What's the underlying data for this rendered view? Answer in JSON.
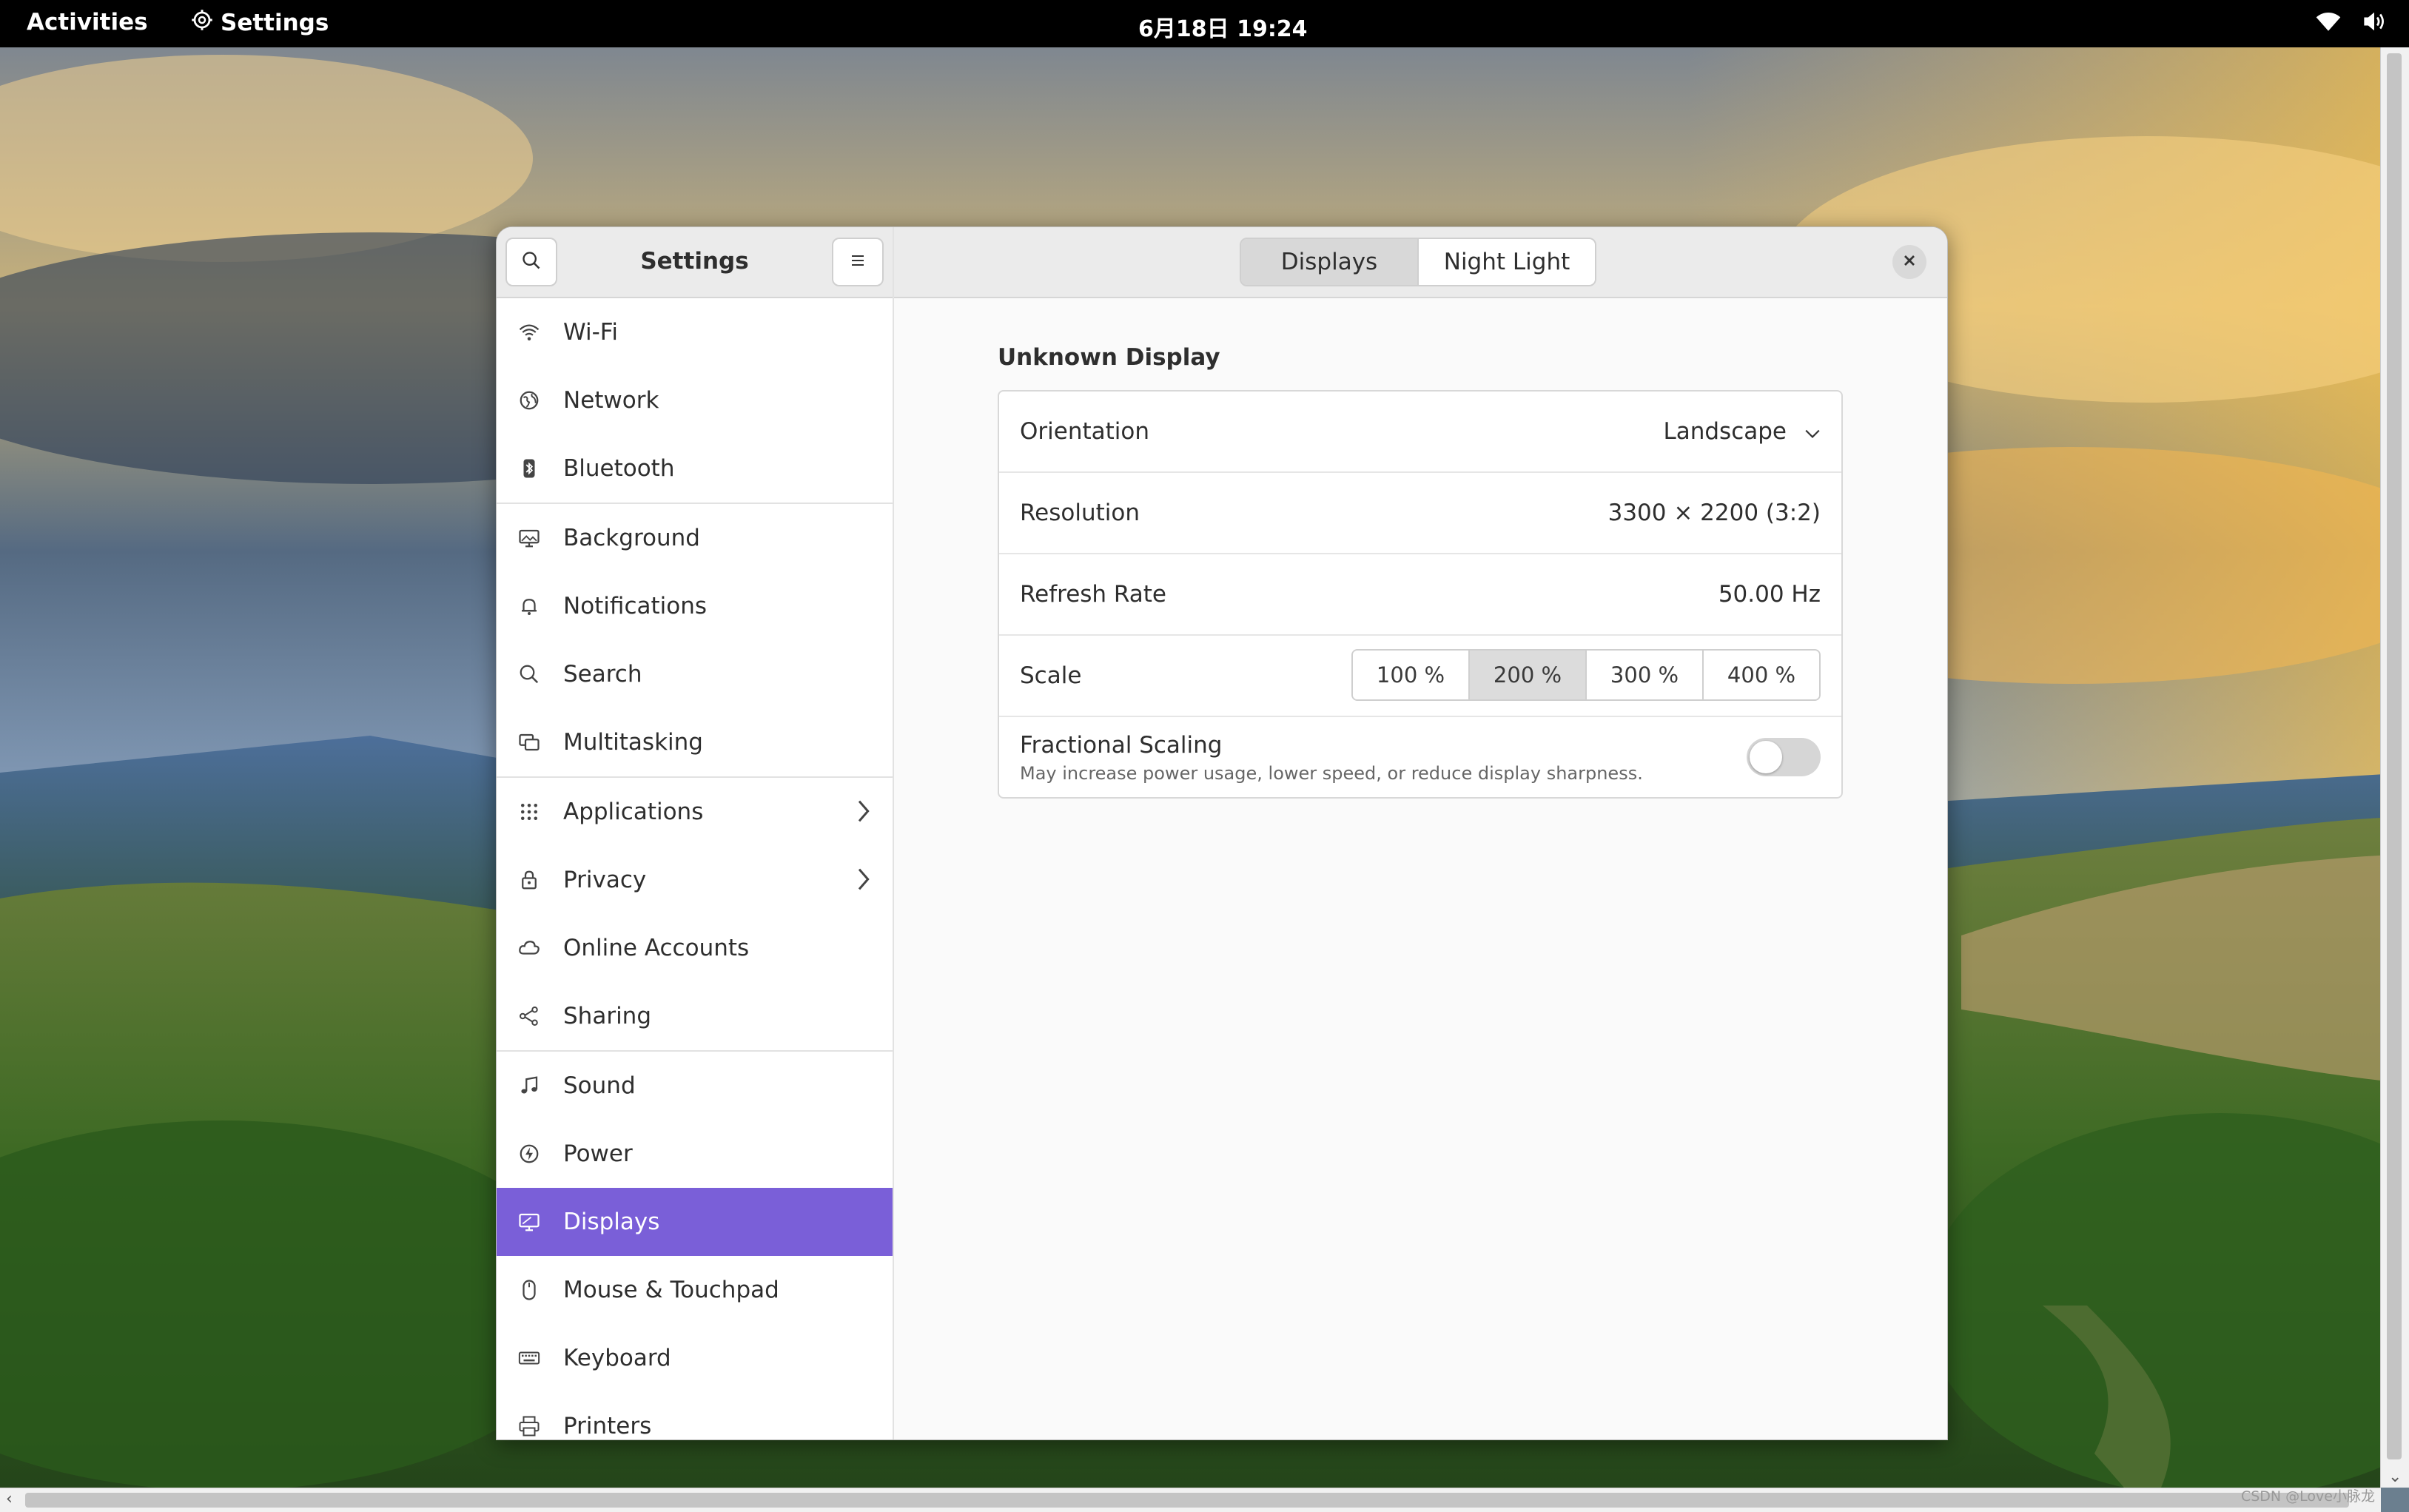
{
  "topbar": {
    "activities": "Activities",
    "app_name": "Settings",
    "clock": "6月18日 19:24",
    "icons": [
      "gear-icon",
      "wifi-icon",
      "volume-icon"
    ]
  },
  "sidebar": {
    "title": "Settings",
    "items": [
      {
        "label": "Wi-Fi",
        "icon": "wifi-icon"
      },
      {
        "label": "Network",
        "icon": "globe-icon"
      },
      {
        "label": "Bluetooth",
        "icon": "bluetooth-icon"
      },
      {
        "label": "Background",
        "icon": "monitor-image-icon"
      },
      {
        "label": "Notifications",
        "icon": "bell-icon"
      },
      {
        "label": "Search",
        "icon": "search-icon"
      },
      {
        "label": "Multitasking",
        "icon": "windows-icon"
      },
      {
        "label": "Applications",
        "icon": "grid-icon"
      },
      {
        "label": "Privacy",
        "icon": "lock-icon"
      },
      {
        "label": "Online Accounts",
        "icon": "cloud-icon"
      },
      {
        "label": "Sharing",
        "icon": "share-icon"
      },
      {
        "label": "Sound",
        "icon": "music-note-icon"
      },
      {
        "label": "Power",
        "icon": "power-icon"
      },
      {
        "label": "Displays",
        "icon": "display-icon"
      },
      {
        "label": "Mouse & Touchpad",
        "icon": "mouse-icon"
      },
      {
        "label": "Keyboard",
        "icon": "keyboard-icon"
      },
      {
        "label": "Printers",
        "icon": "printer-icon"
      }
    ],
    "active": "Displays"
  },
  "tabs": {
    "displays": "Displays",
    "night_light": "Night Light",
    "selected": "Displays"
  },
  "display": {
    "title": "Unknown Display",
    "orientation_label": "Orientation",
    "orientation_value": "Landscape",
    "resolution_label": "Resolution",
    "resolution_value": "3300 × 2200 (3:2)",
    "refresh_label": "Refresh Rate",
    "refresh_value": "50.00 Hz",
    "scale_label": "Scale",
    "scale_options": [
      "100 %",
      "200 %",
      "300 %",
      "400 %"
    ],
    "scale_selected": "200 %",
    "fractional_title": "Fractional Scaling",
    "fractional_subtitle": "May increase power usage, lower speed, or reduce display sharpness.",
    "fractional_enabled": false
  },
  "watermark": "CSDN @Love小脉龙",
  "colors": {
    "accent": "#7a5fd8",
    "topbar": "#000000"
  }
}
